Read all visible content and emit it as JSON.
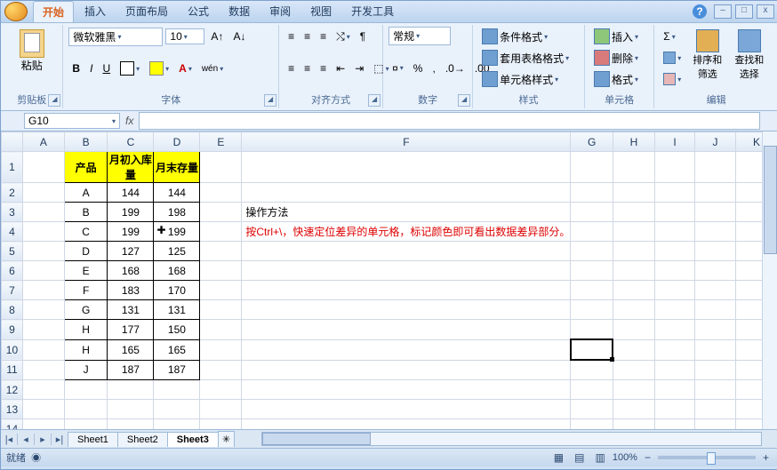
{
  "window": {
    "help": "?"
  },
  "tabs": [
    "开始",
    "插入",
    "页面布局",
    "公式",
    "数据",
    "审阅",
    "视图",
    "开发工具"
  ],
  "tabs_active_index": 0,
  "ribbon": {
    "clipboard": {
      "label": "剪贴板",
      "paste": "粘贴"
    },
    "font": {
      "label": "字体",
      "name": "微软雅黑",
      "size": "10",
      "bold": "B",
      "italic": "I",
      "underline": "U"
    },
    "align": {
      "label": "对齐方式"
    },
    "number": {
      "label": "数字",
      "format": "常规",
      "percent": "%"
    },
    "styles": {
      "label": "样式",
      "cond": "条件格式",
      "table": "套用表格格式",
      "cell": "单元格样式"
    },
    "cells": {
      "label": "单元格",
      "insert": "插入",
      "delete": "删除",
      "format": "格式"
    },
    "editing": {
      "label": "编辑",
      "sigma": "Σ",
      "sort": "排序和\n筛选",
      "find": "查找和\n选择"
    }
  },
  "namebox": "G10",
  "columns": [
    "A",
    "B",
    "C",
    "D",
    "E",
    "F",
    "G",
    "H",
    "I",
    "J",
    "K"
  ],
  "row_count": 14,
  "table": {
    "headers": [
      "产品",
      "月初入库量",
      "月末存量"
    ],
    "rows": [
      [
        "A",
        "144",
        "144"
      ],
      [
        "B",
        "199",
        "198"
      ],
      [
        "C",
        "199",
        "199"
      ],
      [
        "D",
        "127",
        "125"
      ],
      [
        "E",
        "168",
        "168"
      ],
      [
        "F",
        "183",
        "170"
      ],
      [
        "G",
        "131",
        "131"
      ],
      [
        "H",
        "177",
        "150"
      ],
      [
        "H",
        "165",
        "165"
      ],
      [
        "J",
        "187",
        "187"
      ]
    ]
  },
  "notes": {
    "title": "操作方法",
    "tip": "按Ctrl+\\，快速定位差异的单元格，标记颜色即可看出数据差异部分。"
  },
  "active_cell": {
    "row": 10,
    "col": "G"
  },
  "cursor_cell": {
    "row": 4,
    "col": "D"
  },
  "sheets": [
    "Sheet1",
    "Sheet2",
    "Sheet3"
  ],
  "active_sheet": 2,
  "status": {
    "ready": "就绪",
    "zoom": "100%"
  },
  "chart_data": {
    "type": "table",
    "title": "月初入库量 vs 月末存量",
    "categories": [
      "A",
      "B",
      "C",
      "D",
      "E",
      "F",
      "G",
      "H",
      "H",
      "J"
    ],
    "series": [
      {
        "name": "月初入库量",
        "values": [
          144,
          199,
          199,
          127,
          168,
          183,
          131,
          177,
          165,
          187
        ]
      },
      {
        "name": "月末存量",
        "values": [
          144,
          198,
          199,
          125,
          168,
          170,
          131,
          150,
          165,
          187
        ]
      }
    ]
  }
}
